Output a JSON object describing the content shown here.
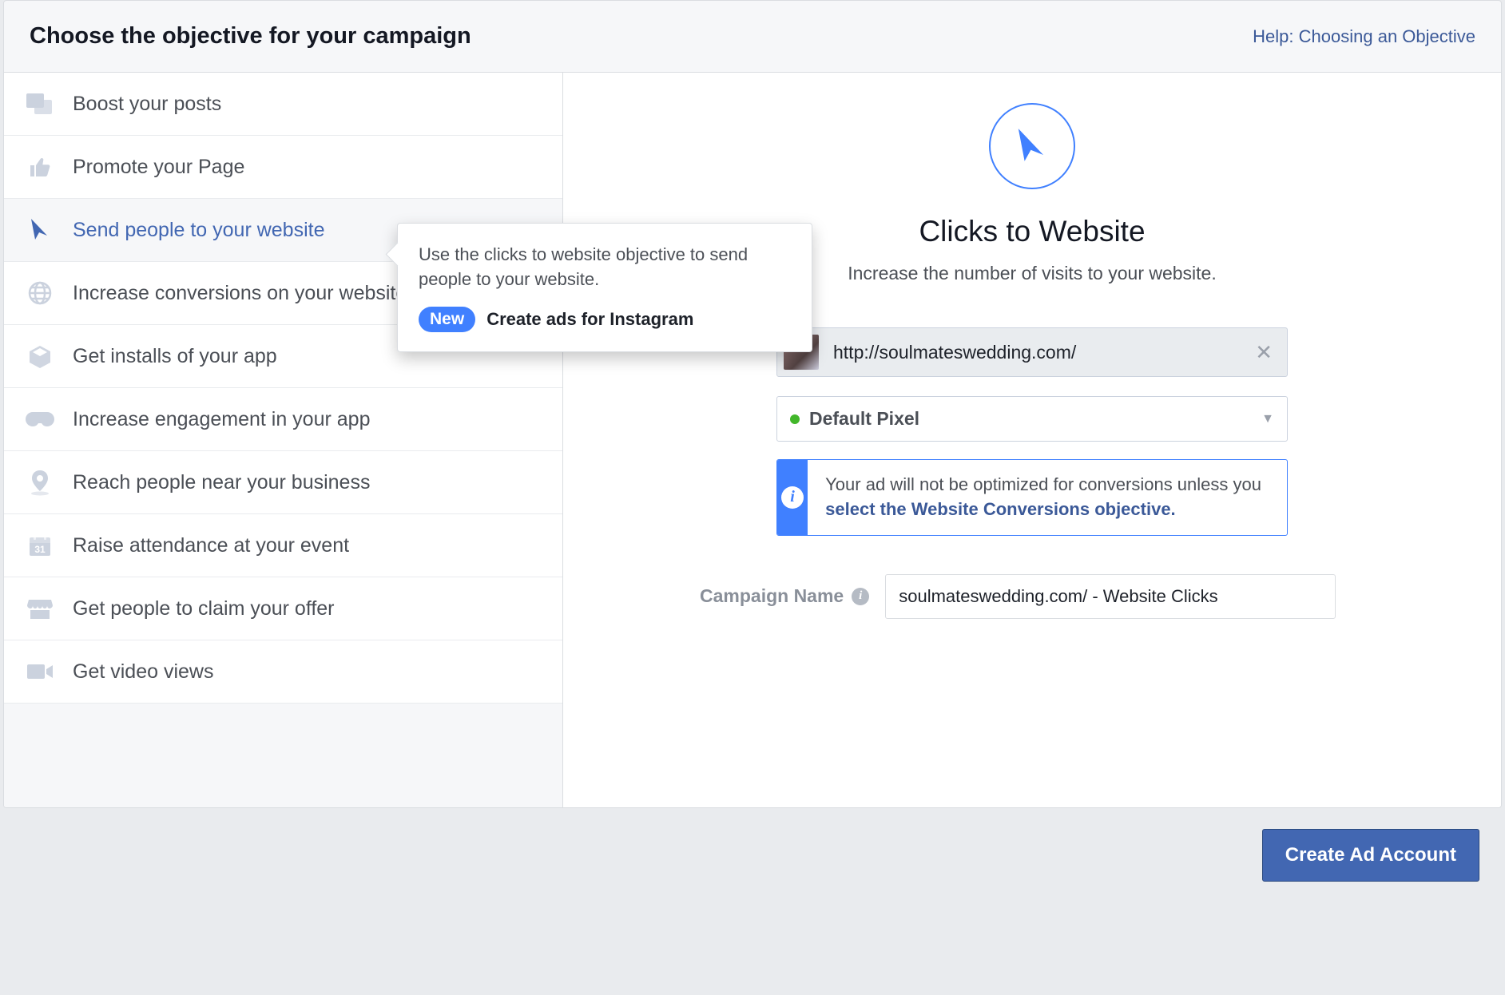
{
  "header": {
    "title": "Choose the objective for your campaign",
    "help_link": "Help: Choosing an Objective"
  },
  "objectives": [
    {
      "key": "boost-posts",
      "label": "Boost your posts"
    },
    {
      "key": "promote-page",
      "label": "Promote your Page"
    },
    {
      "key": "send-website",
      "label": "Send people to your website"
    },
    {
      "key": "conversions",
      "label": "Increase conversions on your website"
    },
    {
      "key": "app-installs",
      "label": "Get installs of your app"
    },
    {
      "key": "app-engagement",
      "label": "Increase engagement in your app"
    },
    {
      "key": "local-awareness",
      "label": "Reach people near your business"
    },
    {
      "key": "event",
      "label": "Raise attendance at your event"
    },
    {
      "key": "offer",
      "label": "Get people to claim your offer"
    },
    {
      "key": "video-views",
      "label": "Get video views"
    }
  ],
  "tooltip": {
    "text": "Use the clicks to website objective to send people to your website.",
    "badge": "New",
    "badge_text": "Create ads for Instagram"
  },
  "details": {
    "title": "Clicks to Website",
    "subtitle": "Increase the number of visits to your website.",
    "url_value": "http://soulmateswedding.com/",
    "pixel_label": "Default Pixel",
    "info_text": "Your ad will not be optimized for conversions unless you ",
    "info_link": "select the Website Conversions objective.",
    "campaign_name_label": "Campaign Name",
    "campaign_name_value": "soulmateswedding.com/ - Website Clicks"
  },
  "footer": {
    "cta": "Create Ad Account"
  }
}
